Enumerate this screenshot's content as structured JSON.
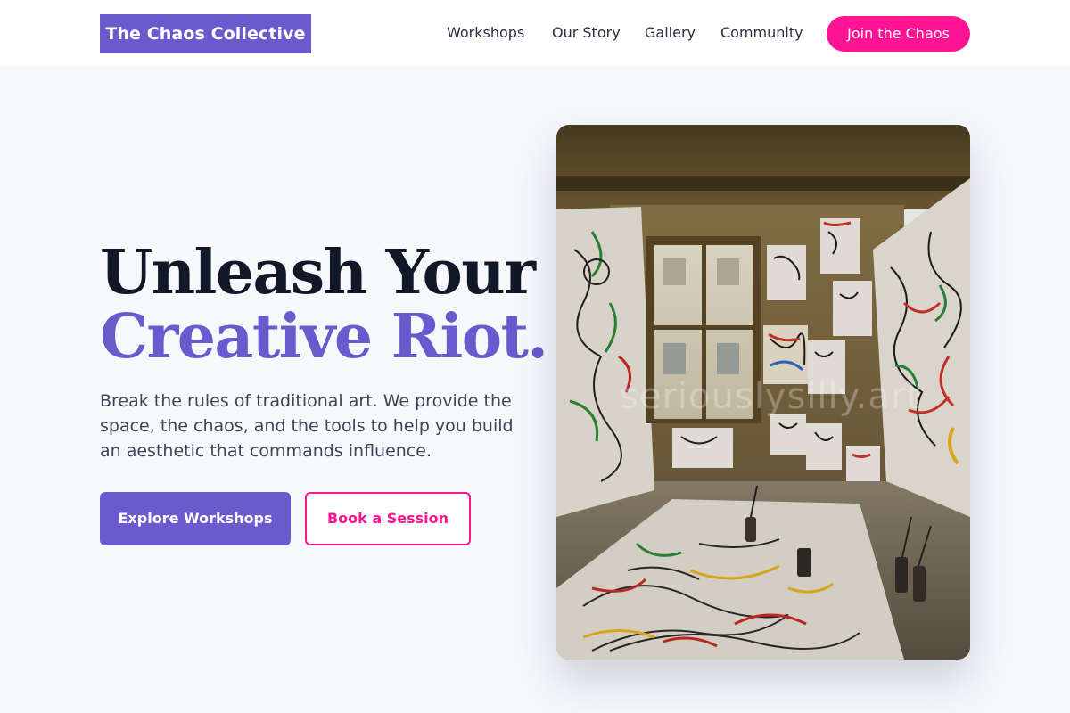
{
  "header": {
    "logo": "The Chaos Collective",
    "nav": [
      "Workshops",
      "Our Story",
      "Gallery",
      "Community"
    ],
    "cta": "Join the Chaos"
  },
  "hero": {
    "title_line1": "Unleash Your",
    "title_line2": "Creative Riot.",
    "description": "Break the rules of traditional art. We provide the space, the chaos, and the tools to help you build an aesthetic that commands influence.",
    "primary_button": "Explore Workshops",
    "secondary_button": "Book a Session",
    "image_watermark": "seriouslysilly.art"
  },
  "colors": {
    "brand_purple": "#6a5acd",
    "accent_pink": "#ff1493",
    "heading_dark": "#111827",
    "background": "#f7f8fc"
  },
  "icons": {
    "image": "art-studio-photo"
  }
}
